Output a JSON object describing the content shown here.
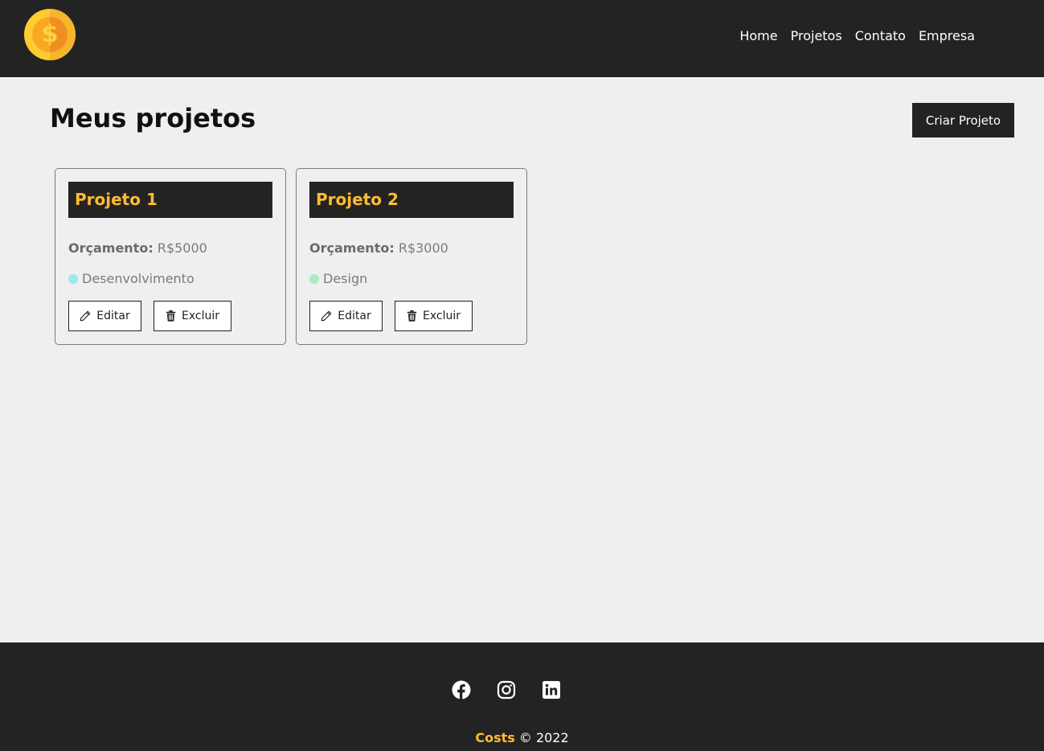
{
  "nav": {
    "logo": "coin-logo",
    "logo_symbol": "$",
    "links": [
      "Home",
      "Projetos",
      "Contato",
      "Empresa"
    ]
  },
  "main": {
    "title": "Meus projetos",
    "create_button": "Criar Projeto"
  },
  "projects": [
    {
      "name": "Projeto 1",
      "budget_label": "Orçamento:",
      "budget_value": "R$5000",
      "category": "Desenvolvimento",
      "category_color": "#9ce7ea",
      "edit_label": "Editar",
      "delete_label": "Excluir"
    },
    {
      "name": "Projeto 2",
      "budget_label": "Orçamento:",
      "budget_value": "R$3000",
      "category": "Design",
      "category_color": "#a9ecc6",
      "edit_label": "Editar",
      "delete_label": "Excluir"
    }
  ],
  "footer": {
    "social": [
      "facebook-icon",
      "instagram-icon",
      "linkedin-icon"
    ],
    "brand": "Costs",
    "copyright": "© 2022"
  },
  "colors": {
    "dark": "#232323",
    "accent": "#ffbb33",
    "background": "#efefef"
  }
}
